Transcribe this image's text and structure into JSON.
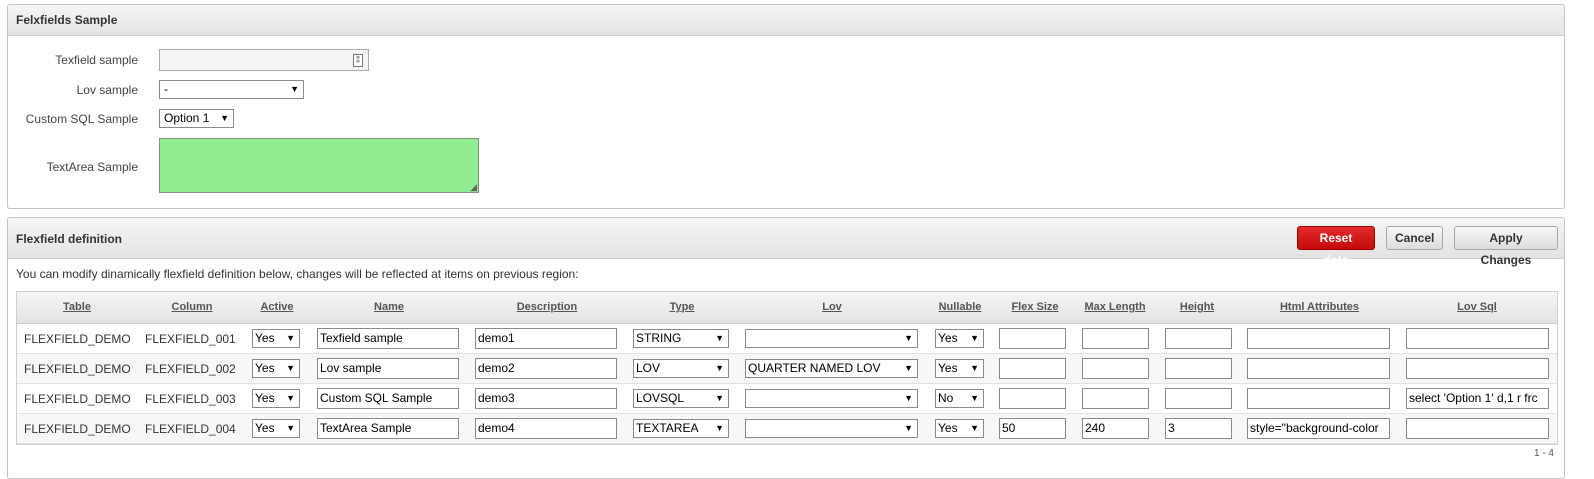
{
  "region1": {
    "title": "Felxfields Sample",
    "textfield_label": "Texfield sample",
    "textfield_value": "",
    "lov_label": "Lov sample",
    "lov_value": "-",
    "custom_sql_label": "Custom SQL Sample",
    "custom_sql_value": "Option 1",
    "textarea_label": "TextArea Sample",
    "textarea_value": "",
    "textarea_bg": "#90ee90"
  },
  "region2": {
    "title": "Flexfield definition",
    "buttons": {
      "reset": "Reset data",
      "cancel": "Cancel",
      "apply": "Apply Changes"
    },
    "info": "You can modify dinamically flexfield definition below, changes will be reflected at items on previous region:",
    "columns": [
      "Table",
      "Column",
      "Active",
      "Name",
      "Description",
      "Type",
      "Lov",
      "Nullable",
      "Flex Size",
      "Max Length",
      "Height",
      "Html Attributes",
      "Lov Sql"
    ],
    "rows": [
      {
        "table": "FLEXFIELD_DEMO",
        "column": "FLEXFIELD_001",
        "active": "Yes",
        "name": "Texfield sample",
        "description": "demo1",
        "type": "STRING",
        "lov": "",
        "nullable": "Yes",
        "flex_size": "",
        "max_length": "",
        "height": "",
        "html_attributes": "",
        "lov_sql": ""
      },
      {
        "table": "FLEXFIELD_DEMO",
        "column": "FLEXFIELD_002",
        "active": "Yes",
        "name": "Lov sample",
        "description": "demo2",
        "type": "LOV",
        "lov": "QUARTER NAMED LOV",
        "nullable": "Yes",
        "flex_size": "",
        "max_length": "",
        "height": "",
        "html_attributes": "",
        "lov_sql": ""
      },
      {
        "table": "FLEXFIELD_DEMO",
        "column": "FLEXFIELD_003",
        "active": "Yes",
        "name": "Custom SQL Sample",
        "description": "demo3",
        "type": "LOVSQL",
        "lov": "",
        "nullable": "No",
        "flex_size": "",
        "max_length": "",
        "height": "",
        "html_attributes": "",
        "lov_sql": "select 'Option 1' d,1 r frc"
      },
      {
        "table": "FLEXFIELD_DEMO",
        "column": "FLEXFIELD_004",
        "active": "Yes",
        "name": "TextArea Sample",
        "description": "demo4",
        "type": "TEXTAREA",
        "lov": "",
        "nullable": "Yes",
        "flex_size": "50",
        "max_length": "240",
        "height": "3",
        "html_attributes": "style=\"background-color",
        "lov_sql": ""
      }
    ],
    "pagination": "1 - 4"
  },
  "colors": {
    "accent_red": "#d40c0c",
    "header_bg": "#e8e8e8"
  },
  "icons": {
    "textfield_icon": "popup-icon",
    "select_arrow": "chevron-down-icon",
    "textarea_grip": "resize-grip-icon"
  }
}
